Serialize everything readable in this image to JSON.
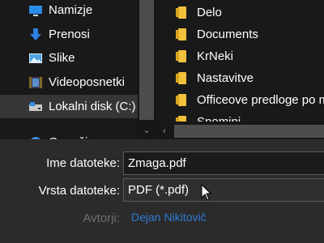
{
  "nav": {
    "items": [
      {
        "label": "Namizje",
        "icon": "desktop-icon"
      },
      {
        "label": "Prenosi",
        "icon": "download-arrow-icon"
      },
      {
        "label": "Slike",
        "icon": "pictures-icon"
      },
      {
        "label": "Videoposnetki",
        "icon": "videos-icon"
      },
      {
        "label": "Lokalni disk (C:)",
        "icon": "drive-icon",
        "selected": true
      },
      {
        "label": "Omrežje",
        "icon": "network-icon"
      }
    ]
  },
  "folders": [
    {
      "label": "Delo"
    },
    {
      "label": "Documents"
    },
    {
      "label": "KrNeki"
    },
    {
      "label": "Nastavitve"
    },
    {
      "label": "Officeove predloge po m"
    },
    {
      "label": "Spomini"
    }
  ],
  "form": {
    "filename_label": "Ime datoteke:",
    "filename_value": "Zmaga.pdf",
    "filetype_label": "Vrsta datoteke:",
    "filetype_value": "PDF (*.pdf)",
    "authors_label": "Avtorji:",
    "authors_value": "Dejan Nikitovič"
  },
  "colors": {
    "folder": "#f2c23c",
    "link": "#2e7bd6",
    "selection": "#363636"
  }
}
